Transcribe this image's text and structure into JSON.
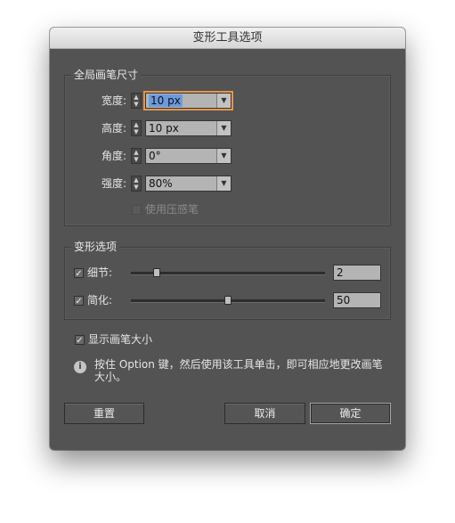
{
  "dialog": {
    "title": "变形工具选项"
  },
  "brush_group": {
    "title": "全局画笔尺寸",
    "rows": [
      {
        "label": "宽度:",
        "value": "10 px"
      },
      {
        "label": "高度:",
        "value": "10 px"
      },
      {
        "label": "角度:",
        "value": "0°"
      },
      {
        "label": "强度:",
        "value": "80%"
      }
    ],
    "pressure_label": "使用压感笔",
    "pressure_checked": false
  },
  "warp_group": {
    "title": "变形选项",
    "detail": {
      "label": "细节:",
      "value": "2",
      "checked": true,
      "slider_fraction": 0.12
    },
    "simplify": {
      "label": "简化:",
      "value": "50",
      "checked": true,
      "slider_fraction": 0.5
    }
  },
  "show_brush_size": {
    "label": "显示画笔大小",
    "checked": true
  },
  "info_text": "按住 Option 键，然后使用该工具单击，即可相应地更改画笔大小。",
  "buttons": {
    "reset": "重置",
    "cancel": "取消",
    "ok": "确定"
  },
  "icons": {
    "checkmark": "✓",
    "info": "i",
    "dropdown": "▼",
    "stepper_up": "▲",
    "stepper_down": "▼"
  }
}
